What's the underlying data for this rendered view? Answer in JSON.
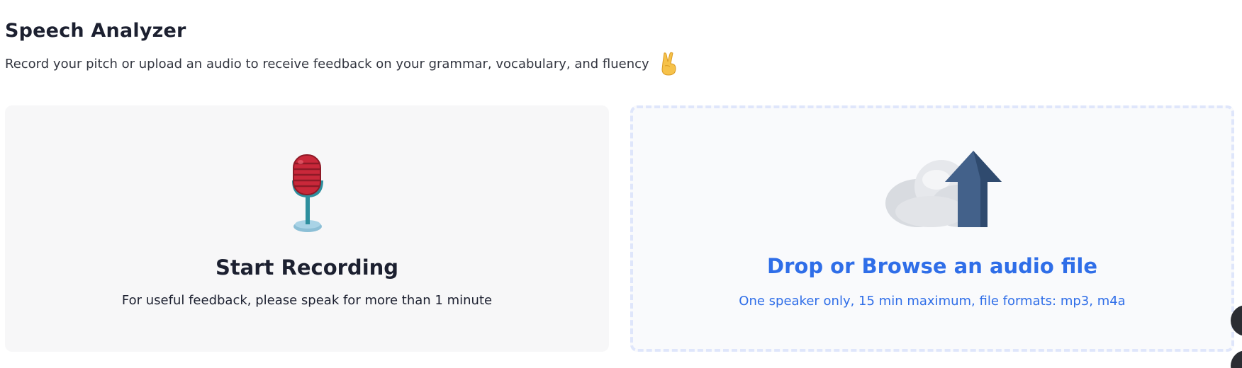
{
  "header": {
    "title": "Speech Analyzer",
    "subtitle": "Record your pitch or upload an audio to receive feedback on your grammar, vocabulary, and fluency",
    "subtitle_emoji": "victory-hand-emoji"
  },
  "record_card": {
    "icon": "microphone-icon",
    "title": "Start Recording",
    "description": "For useful feedback, please speak for more than 1 minute"
  },
  "upload_card": {
    "icon": "cloud-upload-icon",
    "title": "Drop or Browse an audio file",
    "description": "One speaker only, 15 min maximum, file formats: mp3, m4a"
  },
  "colors": {
    "accent": "#2f6ee8",
    "record_bg": "#f7f7f8",
    "upload_bg": "#f9fafc",
    "upload_border": "#dfe6fb",
    "text_dark": "#1c2030"
  }
}
